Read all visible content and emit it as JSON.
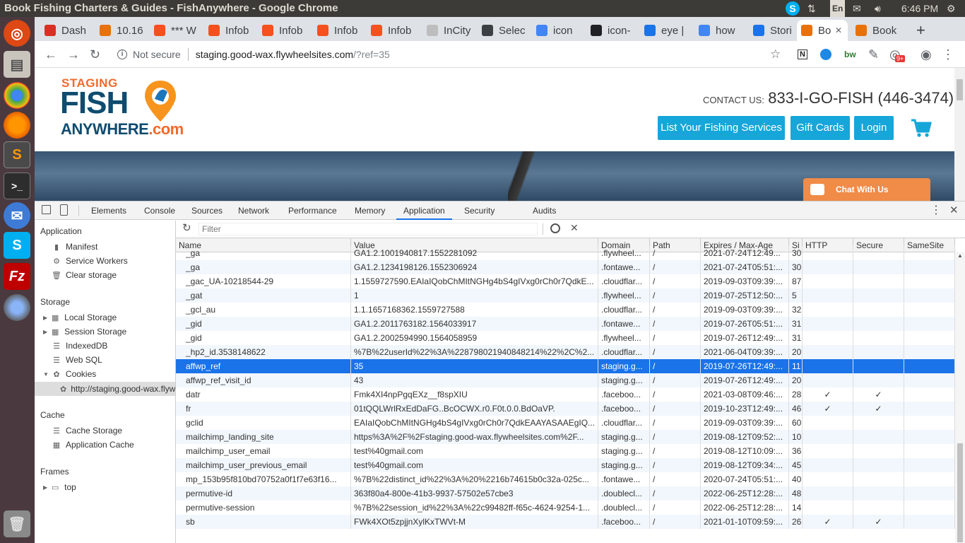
{
  "window_title": "Book Fishing Charters & Guides - FishAnywhere - Google Chrome",
  "system": {
    "lang": "En",
    "time": "6:46 PM"
  },
  "tabs": [
    {
      "label": "Dash",
      "color": "#d93025"
    },
    {
      "label": "10.16",
      "color": "#e8710a"
    },
    {
      "label": "*** W",
      "color": "#f4511e"
    },
    {
      "label": "Infob",
      "color": "#f4511e"
    },
    {
      "label": "Infob",
      "color": "#f4511e"
    },
    {
      "label": "Infob",
      "color": "#f4511e"
    },
    {
      "label": "Infob",
      "color": "#f4511e"
    },
    {
      "label": "InCity",
      "color": "#bdbdbd"
    },
    {
      "label": "Selec",
      "color": "#3c4043"
    },
    {
      "label": "icon",
      "color": "#4285f4"
    },
    {
      "label": "icon-",
      "color": "#202124"
    },
    {
      "label": "eye |",
      "color": "#1a73e8"
    },
    {
      "label": "how",
      "color": "#4285f4"
    },
    {
      "label": "Stori",
      "color": "#1a73e8"
    },
    {
      "label": "Bo",
      "color": "#e8710a"
    },
    {
      "label": "Book",
      "color": "#e8710a"
    }
  ],
  "address": {
    "security": "Not secure",
    "host": "staging.good-wax.flywheelsites.com",
    "path": "/?ref=35"
  },
  "ext_badge": "9+",
  "site": {
    "logo_line1": "STAGING",
    "logo_line2": "FISH",
    "logo_line3": "ANYWHERE",
    "logo_line3b": ".com",
    "contact_label": "CONTACT US:",
    "contact_phone": "833-I-GO-FISH (446-3474)",
    "btn_list": "List Your Fishing Services",
    "btn_gift": "Gift Cards",
    "btn_login": "Login",
    "chat": "Chat With Us"
  },
  "devtools": {
    "tabs": [
      "Elements",
      "Console",
      "Sources",
      "Network",
      "Performance",
      "Memory",
      "Application",
      "Security",
      "Audits"
    ],
    "filter_placeholder": "Filter",
    "sections": {
      "application": "Application",
      "manifest": "Manifest",
      "service_workers": "Service Workers",
      "clear_storage": "Clear storage",
      "storage": "Storage",
      "local_storage": "Local Storage",
      "session_storage": "Session Storage",
      "indexeddb": "IndexedDB",
      "websql": "Web SQL",
      "cookies": "Cookies",
      "cookie_origin": "http://staging.good-wax.flywheelsites.com",
      "cache": "Cache",
      "cache_storage": "Cache Storage",
      "app_cache": "Application Cache",
      "frames": "Frames",
      "top": "top"
    },
    "columns": [
      "Name",
      "Value",
      "Domain",
      "Path",
      "Expires / Max-Age",
      "Si",
      "HTTP",
      "Secure",
      "SameSite"
    ],
    "rows": [
      [
        "_ga",
        "GA1.2.1001940817.1552281092",
        ".flywheel...",
        "/",
        "2021-07-24T12:49...",
        "30",
        "",
        "",
        ""
      ],
      [
        "_ga",
        "GA1.2.1234198126.1552306924",
        ".fontawe...",
        "/",
        "2021-07-24T05:51:...",
        "30",
        "",
        "",
        ""
      ],
      [
        "_gac_UA-10218544-29",
        "1.1559727590.EAIaIQobChMItNGHg4bS4gIVxg0rCh0r7QdkE...",
        ".cloudflar...",
        "/",
        "2019-09-03T09:39:...",
        "87",
        "",
        "",
        ""
      ],
      [
        "_gat",
        "1",
        ".flywheel...",
        "/",
        "2019-07-25T12:50:...",
        "5",
        "",
        "",
        ""
      ],
      [
        "_gcl_au",
        "1.1.1657168362.1559727588",
        ".cloudflar...",
        "/",
        "2019-09-03T09:39:...",
        "32",
        "",
        "",
        ""
      ],
      [
        "_gid",
        "GA1.2.2011763182.1564033917",
        ".fontawe...",
        "/",
        "2019-07-26T05:51:...",
        "31",
        "",
        "",
        ""
      ],
      [
        "_gid",
        "GA1.2.2002594990.1564058959",
        ".flywheel...",
        "/",
        "2019-07-26T12:49:...",
        "31",
        "",
        "",
        ""
      ],
      [
        "_hp2_id.3538148622",
        "%7B%22userId%22%3A%228798021940848214%22%2C%2...",
        ".cloudflar...",
        "/",
        "2021-06-04T09:39:...",
        "20",
        "",
        "",
        ""
      ],
      [
        "affwp_ref",
        "35",
        "staging.g...",
        "/",
        "2019-07-26T12:49:...",
        "11",
        "",
        "",
        ""
      ],
      [
        "affwp_ref_visit_id",
        "43",
        "staging.g...",
        "/",
        "2019-07-26T12:49:...",
        "20",
        "",
        "",
        ""
      ],
      [
        "datr",
        "Fmk4XI4npPgqEXz__f8spXIU",
        ".faceboo...",
        "/",
        "2021-03-08T09:46:...",
        "28",
        "✓",
        "✓",
        ""
      ],
      [
        "fr",
        "01tQQLWrlRxEdDaFG..BcOCWX.r0.F0t.0.0.BdOaVP.",
        ".faceboo...",
        "/",
        "2019-10-23T12:49:...",
        "46",
        "✓",
        "✓",
        ""
      ],
      [
        "gclid",
        "EAIaIQobChMItNGHg4bS4gIVxg0rCh0r7QdkEAAYASAAEgIQ...",
        ".cloudflar...",
        "/",
        "2019-09-03T09:39:...",
        "60",
        "",
        "",
        ""
      ],
      [
        "mailchimp_landing_site",
        "https%3A%2F%2Fstaging.good-wax.flywheelsites.com%2F...",
        "staging.g...",
        "/",
        "2019-08-12T09:52:...",
        "10",
        "",
        "",
        ""
      ],
      [
        "mailchimp_user_email",
        "test%40gmail.com",
        "staging.g...",
        "/",
        "2019-08-12T10:09:...",
        "36",
        "",
        "",
        ""
      ],
      [
        "mailchimp_user_previous_email",
        "test%40gmail.com",
        "staging.g...",
        "/",
        "2019-08-12T09:34:...",
        "45",
        "",
        "",
        ""
      ],
      [
        "mp_153b95f810bd70752a0f1f7e63f16...",
        "%7B%22distinct_id%22%3A%20%2216b74615b0c32a-025c...",
        ".fontawe...",
        "/",
        "2020-07-24T05:51:...",
        "40",
        "",
        "",
        ""
      ],
      [
        "permutive-id",
        "363f80a4-800e-41b3-9937-57502e57cbe3",
        ".doublecl...",
        "/",
        "2022-06-25T12:28:...",
        "48",
        "",
        "",
        ""
      ],
      [
        "permutive-session",
        "%7B%22session_id%22%3A%22c99482ff-f65c-4624-9254-1...",
        ".doublecl...",
        "/",
        "2022-06-25T12:28:...",
        "14",
        "",
        "",
        ""
      ],
      [
        "sb",
        "FWk4XOt5zpjjnXylKxTWVt-M",
        ".faceboo...",
        "/",
        "2021-01-10T09:59:...",
        "26",
        "✓",
        "✓",
        ""
      ]
    ],
    "selected_row": 8
  }
}
